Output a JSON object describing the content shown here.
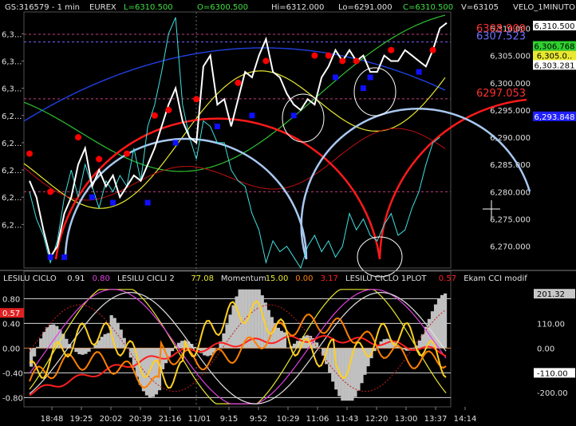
{
  "header": {
    "symbol": "GS:316579 - 1 min",
    "exchange": "EUREX",
    "last": "L=6310.500",
    "open": "O=6300.500",
    "high": "Hi=6312.000",
    "low": "Lo=6291.000",
    "close": "C=6310.500",
    "volume": "V=63105",
    "indicator": "VELO_1MINUTO"
  },
  "colors": {
    "background": "#000000",
    "price": "#ffffff",
    "cyan": "#40e0e0",
    "red_dots": "#ff0000",
    "blue_dots": "#1010ff",
    "arc_red": "#ff1a1a",
    "arc_lightblue": "#a8c8f0",
    "green": "#30c030",
    "yellow": "#e8e830",
    "blue_curve": "#2040e0",
    "dark_red": "#c01010",
    "gray_hist": "#c0c0c0",
    "orange": "#ff8000",
    "magenta": "#e040e0"
  },
  "chart_data": [
    {
      "type": "line",
      "title": "",
      "ylim": [
        6266,
        6313
      ],
      "y_ticks": [
        6270,
        6275,
        6280,
        6285,
        6290,
        6295,
        6300,
        6305,
        6310
      ],
      "y_tick_labels": [
        "6,270.000",
        "6,275.000",
        "6,280.000",
        "6,285.000",
        "6,290.000",
        "6,295.000",
        "6,300.000",
        "6,305.000",
        "6,310.000"
      ],
      "left_tick_labels": [
        "6,3...",
        "6,3...",
        "6,3...",
        "6,2...",
        "6,2...",
        "6,2...",
        "6,2...",
        "6,2..."
      ],
      "left_tick_values": [
        6309,
        6304,
        6299,
        6294,
        6289,
        6284,
        6279,
        6274,
        6269
      ],
      "price_labels": [
        {
          "value": 6310.5,
          "text": "6,310.500",
          "bg": "#ffffff",
          "fg": "#000000"
        },
        {
          "value": 6306.768,
          "text": "6,306.768",
          "bg": "#30d030",
          "fg": "#000000"
        },
        {
          "value": 6305.0,
          "text": "6,305.0..",
          "bg": "#e8e830",
          "fg": "#000000"
        },
        {
          "value": 6303.281,
          "text": "6,303.281",
          "bg": "#ffffff",
          "fg": "#000000"
        },
        {
          "value": 6293.848,
          "text": "6,293.848",
          "bg": "#2020ff",
          "fg": "#ffffff"
        }
      ],
      "reference_lines": [
        {
          "value": 6308.909,
          "label": "6308.909"
        },
        {
          "value": 6307.5,
          "label": "6307.523"
        },
        {
          "value": 6297.053,
          "label": "6297.053"
        },
        {
          "value": 6280.0,
          "label": ""
        }
      ],
      "x_tick_labels": [
        "18:48",
        "19:25",
        "20:02",
        "20:39",
        "21:16",
        "11/01",
        "9:15",
        "9:52",
        "10:29",
        "11:06",
        "11:43",
        "12:20",
        "13:00",
        "13:37",
        "14:14"
      ],
      "series": [
        {
          "key": "price",
          "values": [
            6282,
            6279,
            6273,
            6268,
            6270,
            6276,
            6279,
            6285,
            6288,
            6281,
            6284,
            6281,
            6283,
            6279,
            6281,
            6283,
            6282,
            6285,
            6288,
            6292,
            6296,
            6299,
            6293,
            6290,
            6289,
            6303,
            6305,
            6296,
            6297,
            6292,
            6297,
            6302,
            6301,
            6305,
            6308,
            6302,
            6301,
            6298,
            6296,
            6295,
            6297,
            6296,
            6301,
            6303,
            6306,
            6304,
            6306,
            6304,
            6305,
            6302,
            6302,
            6305,
            6304,
            6304,
            6306,
            6305,
            6304,
            6303,
            6306,
            6310,
            6311
          ]
        },
        {
          "key": "cyan",
          "values": [
            6280,
            6275,
            6272,
            6267,
            6271,
            6279,
            6284,
            6279,
            6285,
            6281,
            6277,
            6282,
            6280,
            6283,
            6281,
            6288,
            6282,
            6292,
            6296,
            6302,
            6309,
            6312,
            6296,
            6290,
            6286,
            6293,
            6292,
            6289,
            6289,
            6284,
            6282,
            6281,
            6276,
            6273,
            6267,
            6271,
            6269,
            6270,
            6268,
            6266,
            6270,
            6272,
            6269,
            6271,
            6268,
            6270,
            6276,
            6273,
            6275,
            6272,
            6271,
            6274,
            6276,
            6272,
            6273,
            6277,
            6280,
            6285,
            6289,
            6290
          ]
        }
      ],
      "red_dots": [
        [
          0,
          6287
        ],
        [
          3,
          6280
        ],
        [
          7,
          6290
        ],
        [
          10,
          6286
        ],
        [
          14,
          6287
        ],
        [
          18,
          6294
        ],
        [
          20,
          6295
        ],
        [
          24,
          6297
        ],
        [
          30,
          6300
        ],
        [
          34,
          6304
        ],
        [
          41,
          6305
        ],
        [
          43,
          6305
        ],
        [
          45,
          6304
        ],
        [
          47,
          6304
        ],
        [
          52,
          6306
        ],
        [
          58,
          6306
        ]
      ],
      "blue_dots": [
        [
          3,
          6268
        ],
        [
          5,
          6268
        ],
        [
          9,
          6279
        ],
        [
          12,
          6278
        ],
        [
          17,
          6278
        ],
        [
          21,
          6289
        ],
        [
          27,
          6292
        ],
        [
          32,
          6294
        ],
        [
          38,
          6294
        ],
        [
          44,
          6301
        ],
        [
          48,
          6299
        ],
        [
          49,
          6301
        ],
        [
          56,
          6302
        ]
      ]
    },
    {
      "type": "line",
      "title": "",
      "ylim": [
        -0.95,
        1.05
      ],
      "legend": [
        {
          "text": "LESILU CICLO",
          "color": "#e0e0e0"
        },
        {
          "text": "0.91",
          "color": "#e0e0e0"
        },
        {
          "text": "0.80",
          "color": "#e040e0"
        },
        {
          "text": "LESILU CICLI 2",
          "color": "#e0e0e0"
        },
        {
          "text": "77.08",
          "color": "#e8e830"
        },
        {
          "text": "Momentum",
          "color": "#e0e0e0"
        },
        {
          "text": "15.00",
          "color": "#e8e830"
        },
        {
          "text": "0.00",
          "color": "#ff8000"
        },
        {
          "text": "3.17",
          "color": "#ff2020"
        },
        {
          "text": "LESILU CICLO 1PLOT",
          "color": "#e0e0e0"
        },
        {
          "text": "0.57",
          "color": "#ff2020"
        },
        {
          "text": "Ekam CCI modif",
          "color": "#e0e0e0"
        }
      ],
      "left_ticks": [
        {
          "value": 0.8,
          "text": "0.80"
        },
        {
          "value": 0.57,
          "text": "0.57"
        },
        {
          "value": 0.4,
          "text": "0.40"
        },
        {
          "value": 0.0,
          "text": "0.00"
        },
        {
          "value": -0.4,
          "text": "-0.40"
        },
        {
          "value": -0.8,
          "text": "-0.80"
        }
      ],
      "right_ticks": [
        {
          "value": 0.88,
          "text": "201.32",
          "box": "gray"
        },
        {
          "value": 0.4,
          "text": "110.00",
          "box": "none"
        },
        {
          "value": 0.0,
          "text": "0.00",
          "box": "none"
        },
        {
          "value": -0.4,
          "text": "-110.00",
          "box": "white"
        },
        {
          "value": -0.72,
          "text": "-200.00",
          "box": "none"
        }
      ]
    }
  ]
}
